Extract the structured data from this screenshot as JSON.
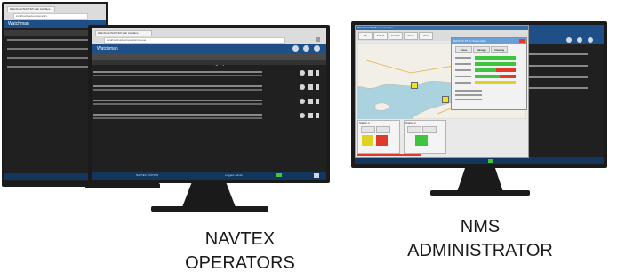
{
  "left_group": {
    "back_monitor": {
      "tab_title": "Watchman/NAVTEX web interface",
      "url": "localhost/navtex/operators",
      "app_title": "Watchman"
    },
    "front_monitor": {
      "tab_title": "Watchman/NAVTEX web interface",
      "url": "localhost/navtex/operators/queue",
      "app_title": "Watchman",
      "panel_title": "NAVTEX message queue",
      "status_left": "NAVTEX STATION",
      "status_right": "Logged: Admin"
    },
    "caption_line1": "NAVTEX",
    "caption_line2": "OPERATORS"
  },
  "right_group": {
    "window_title": "Watchman/NMS web interface",
    "toolbar": [
      "Nr",
      "Select",
      "Confirm",
      "Clear",
      "Exit"
    ],
    "popup_title": "NAVTEX TX Tx Supervision",
    "popup_buttons": [
      "Close",
      "Manage",
      "Clearing"
    ],
    "panel_a_title": "Station 1",
    "panel_b_title": "Station 2",
    "caption_line1": "NMS",
    "caption_line2": "ADMINISTRATOR"
  },
  "colors": {
    "bezel": "#1b1b1b",
    "app_bar": "#1e4f86",
    "screen_dark": "#202020",
    "status_ok": "#3ec43e",
    "status_warn": "#e0d21e",
    "status_alarm": "#e03a2c"
  }
}
